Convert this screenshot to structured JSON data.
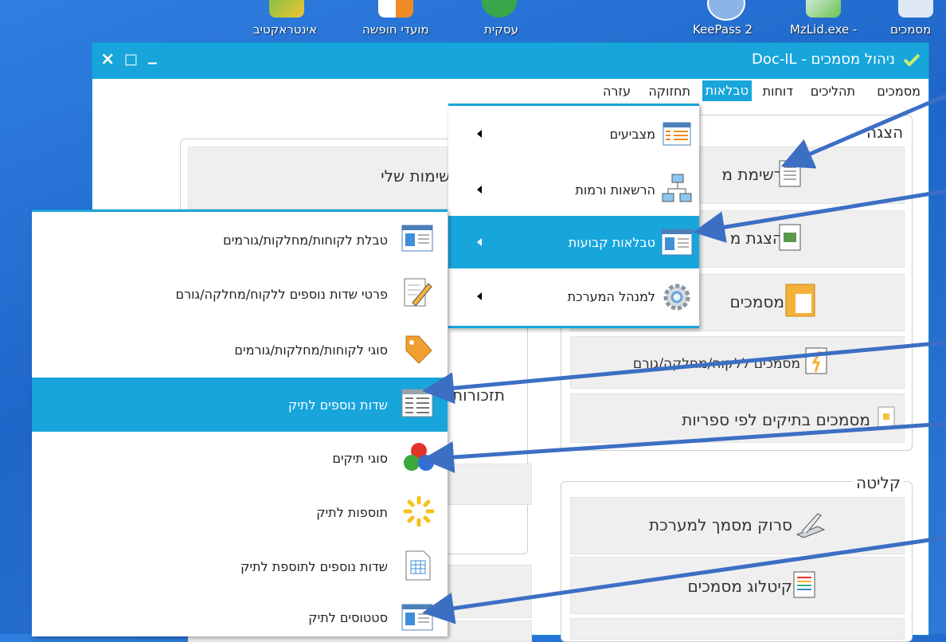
{
  "desktop": {
    "icons": [
      {
        "label": "אינטראקטיב"
      },
      {
        "label": "מועדי חופשה"
      },
      {
        "label": "עסקית"
      },
      {
        "label": "KeePass 2"
      },
      {
        "label": "MzLid.exe -"
      },
      {
        "label": "מסמכים"
      }
    ]
  },
  "window": {
    "title": "ניהול מסמכים - Doc-IL",
    "close_glyph": "×",
    "maximize_glyph": "□",
    "minimize_glyph": "_"
  },
  "menubar": {
    "items": [
      "מסמכים",
      "תהליכים",
      "דוחות",
      "טבלאות",
      "תחזוקה",
      "עזרה"
    ],
    "active": "טבלאות"
  },
  "main": {
    "left_panel_title": "המשימות שלי",
    "reminders_title": "תזכורות",
    "display_section_title": "הצגה",
    "display_tiles": [
      {
        "label": "רשימת מ"
      },
      {
        "label": "הצגת מ"
      },
      {
        "label": "מסמכים"
      },
      {
        "label": "מסמכים ללקוח/מחלקה/גורם"
      },
      {
        "label": "מסמכים בתיקים לפי ספריות"
      }
    ],
    "intake_section_title": "קליטה",
    "intake_tiles": [
      {
        "label": "סרוק מסמך למערכת"
      },
      {
        "label": "קיטלוג מסמכים"
      }
    ]
  },
  "tables_menu": {
    "items": [
      {
        "label": "מצביעים",
        "icon": "table-list-icon"
      },
      {
        "label": "הרשאות ורמות",
        "icon": "network-computers-icon"
      },
      {
        "label": "טבלאות קבועות",
        "icon": "fixed-tables-icon",
        "highlighted": true
      },
      {
        "label": "למנהל המערכת",
        "icon": "gear-icon"
      }
    ]
  },
  "fixed_tables_submenu": {
    "items": [
      {
        "label": "טבלת לקוחות/מחלקות/גורמים",
        "icon": "card-table-icon"
      },
      {
        "label": "פרטי שדות נוספים ללקוח/מחלקה/גורם",
        "icon": "edit-pencil-icon"
      },
      {
        "label": "סוגי לקוחות/מחלקות/גורמים",
        "icon": "tag-icon"
      },
      {
        "label": "שדות נוספים לתיק",
        "icon": "form-grid-icon",
        "highlighted": true
      },
      {
        "label": "סוגי תיקים",
        "icon": "colored-balls-icon"
      },
      {
        "label": "תוספות לתיק",
        "icon": "sparkle-icon"
      },
      {
        "label": "שדות נוספים לתוספת לתיק",
        "icon": "spreadsheet-icon"
      },
      {
        "label": "סטטוסים לתיק",
        "icon": "card-table-icon"
      }
    ]
  },
  "colors": {
    "accent": "#17a5dc",
    "arrow": "#3c6fc4",
    "desktop": "#2470d2"
  }
}
